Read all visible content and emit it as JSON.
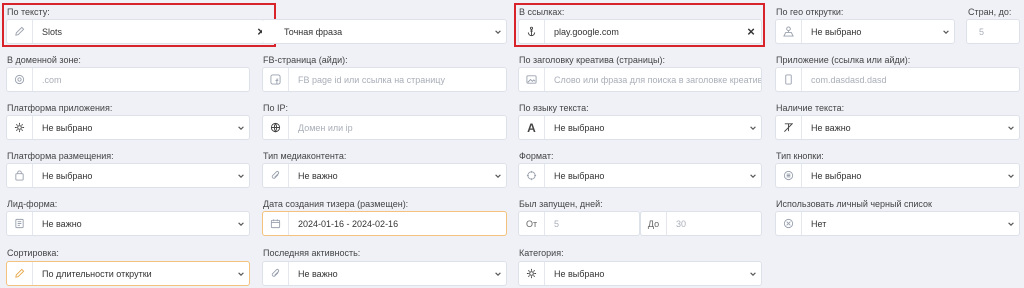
{
  "row1": {
    "text_search": {
      "label": "По тексту:",
      "value": "Slots"
    },
    "phrase_mode": {
      "value": "Точная фраза"
    },
    "links": {
      "label": "В ссылках:",
      "value": "play.google.com"
    },
    "geo": {
      "label": "По гео открутки:",
      "value": "Не выбрано"
    },
    "countries": {
      "label": "Стран, до:",
      "placeholder": "5"
    }
  },
  "row2": {
    "domain": {
      "label": "В доменной зоне:",
      "placeholder": ".com"
    },
    "fb_page": {
      "label": "FB-страница (айди):",
      "placeholder": "FB page id или ссылка на страницу"
    },
    "creative_title": {
      "label": "По заголовку креатива (страницы):",
      "placeholder": "Слово или фраза для поиска в заголовке креатива"
    },
    "app": {
      "label": "Приложение (ссылка или айди):",
      "placeholder": "com.dasdasd.dasd"
    }
  },
  "row3": {
    "app_platform": {
      "label": "Платформа приложения:",
      "value": "Не выбрано"
    },
    "ip": {
      "label": "По IP:",
      "placeholder": "Домен или  ip"
    },
    "text_lang": {
      "label": "По языку текста:",
      "value": "Не выбрано"
    },
    "text_presence": {
      "label": "Наличие текста:",
      "value": "Не важно"
    }
  },
  "row4": {
    "placement": {
      "label": "Платформа размещения:",
      "value": "Не выбрано"
    },
    "media_type": {
      "label": "Тип медиаконтента:",
      "value": "Не важно"
    },
    "format": {
      "label": "Формат:",
      "value": "Не выбрано"
    },
    "button_type": {
      "label": "Тип кнопки:",
      "value": "Не выбрано"
    }
  },
  "row5": {
    "lead_form": {
      "label": "Лид-форма:",
      "value": "Не важно"
    },
    "created_date": {
      "label": "Дата создания тизера (размещен):",
      "value": "2024-01-16 - 2024-02-16"
    },
    "launched_days": {
      "label": "Был запущен, дней:",
      "from_label": "От",
      "from_placeholder": "5",
      "to_label": "До",
      "to_placeholder": "30"
    },
    "blacklist": {
      "label": "Использовать личный черный список",
      "value": "Нет"
    }
  },
  "row6": {
    "sort": {
      "label": "Сортировка:",
      "value": "По длительности открутки"
    },
    "last_activity": {
      "label": "Последняя активность:",
      "value": "Не важно"
    },
    "category": {
      "label": "Категория:",
      "value": "Не выбрано"
    }
  },
  "colors": {
    "highlight_border": "#d8232a",
    "active_field_border": "#f2c27e",
    "background": "#eff1f7"
  }
}
